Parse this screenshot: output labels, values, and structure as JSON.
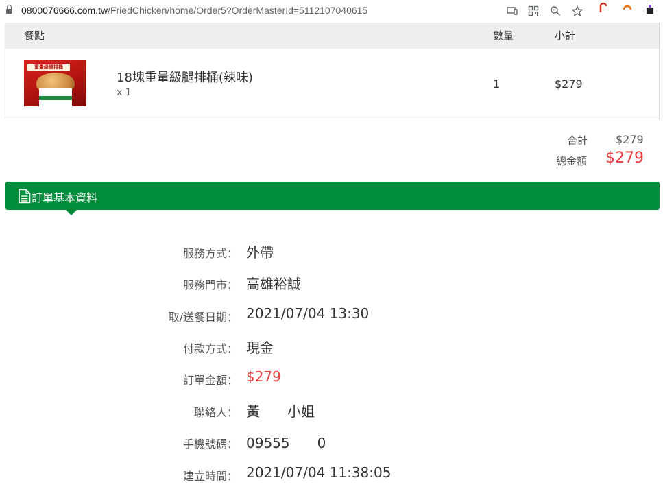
{
  "browser": {
    "url_host": "0800076666.com.tw",
    "url_path": "/FriedChicken/home/Order5?OrderMasterId=5112107040615"
  },
  "items_table": {
    "header": {
      "item": "餐點",
      "qty": "數量",
      "subtotal": "小計"
    },
    "rows": [
      {
        "thumb_text": "重量級腿排桶",
        "name": "18塊重量級腿排桶(辣味)",
        "qty_sub": "x 1",
        "qty": "1",
        "subtotal": "$279"
      }
    ]
  },
  "totals": {
    "sum_label": "合計",
    "sum_value": "$279",
    "grand_label": "總金額",
    "grand_value": "$279",
    "grand_color": "#e8403f"
  },
  "section": {
    "title": "訂單基本資料",
    "color": "#008c3a"
  },
  "details": [
    {
      "label": "服務方式：",
      "value": "外帶"
    },
    {
      "label": "服務門市：",
      "value": "高雄裕誠"
    },
    {
      "label": "取/送餐日期：",
      "value": "2021/07/04 13:30"
    },
    {
      "label": "付款方式：",
      "value": "現金"
    },
    {
      "label": "訂單金額：",
      "value": "$279"
    },
    {
      "label": "聯絡人：",
      "value": "黃　　小姐"
    },
    {
      "label": "手機號碼：",
      "value": "09555　　0"
    },
    {
      "label": "建立時間：",
      "value": "2021/07/04 11:38:05"
    }
  ]
}
